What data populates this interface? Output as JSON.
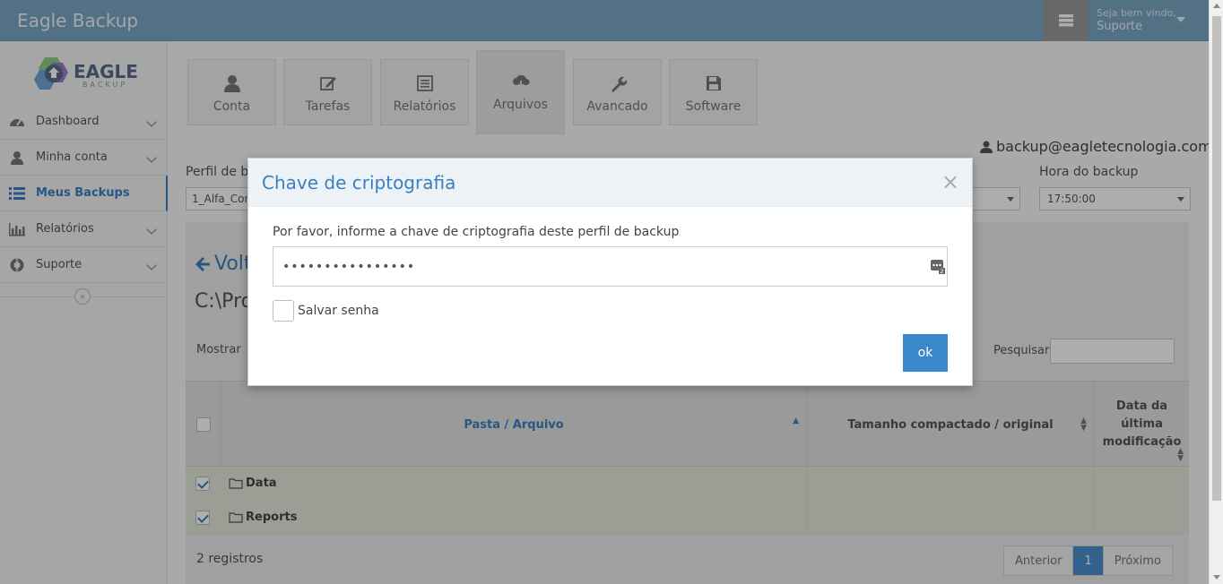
{
  "app": {
    "title": "Eagle Backup"
  },
  "header": {
    "welcome": "Seja bem vindo,",
    "username": "Suporte"
  },
  "logo": {
    "name": "EAGLE",
    "sub": "BACKUP"
  },
  "sidebar": {
    "items": [
      {
        "label": "Dashboard",
        "icon": "dashboard-icon"
      },
      {
        "label": "Minha conta",
        "icon": "user-icon"
      },
      {
        "label": "Meus Backups",
        "icon": "list-icon",
        "active": true
      },
      {
        "label": "Relatórios",
        "icon": "bar-chart-icon"
      },
      {
        "label": "Suporte",
        "icon": "lifebuoy-icon"
      }
    ]
  },
  "tabs": [
    {
      "label": "Conta",
      "icon": "user-icon"
    },
    {
      "label": "Tarefas",
      "icon": "edit-icon"
    },
    {
      "label": "Relatórios",
      "icon": "list-alt-icon"
    },
    {
      "label": "Arquivos",
      "icon": "cloud-download-icon",
      "active": true
    },
    {
      "label": "Avancado",
      "icon": "wrench-icon"
    },
    {
      "label": "Software",
      "icon": "floppy-icon"
    }
  ],
  "account": {
    "email": "backup@eagletecnologia.com"
  },
  "form": {
    "perfil_label": "Perfil de ba",
    "perfil_value": "1_Alfa_Cor",
    "hora_label": "Hora do backup",
    "hora_value": "17:50:00"
  },
  "files": {
    "back_label": "Volt",
    "path": "C:\\Pro",
    "mostrar": "Mostrar",
    "pesquisar": "Pesquisar",
    "columns": [
      "Pasta / Arquivo",
      "Tamanho compactado / original",
      "Data da última modificação"
    ],
    "rows": [
      {
        "name": "Data",
        "checked": true
      },
      {
        "name": "Reports",
        "checked": true
      }
    ],
    "registros": "2 registros",
    "pager": {
      "prev": "Anterior",
      "current": "1",
      "next": "Próximo"
    }
  },
  "modal": {
    "title": "Chave de criptografia",
    "close": "×",
    "prompt": "Por favor, informe a chave de criptografia deste perfil de backup",
    "password_value": "••••••••••••••••",
    "save_label": "Salvar senha",
    "ok_label": "ok"
  },
  "colors": {
    "accent": "#3a87cc",
    "topbar": "#7ba7c4",
    "row_selected": "#e4e9da"
  }
}
